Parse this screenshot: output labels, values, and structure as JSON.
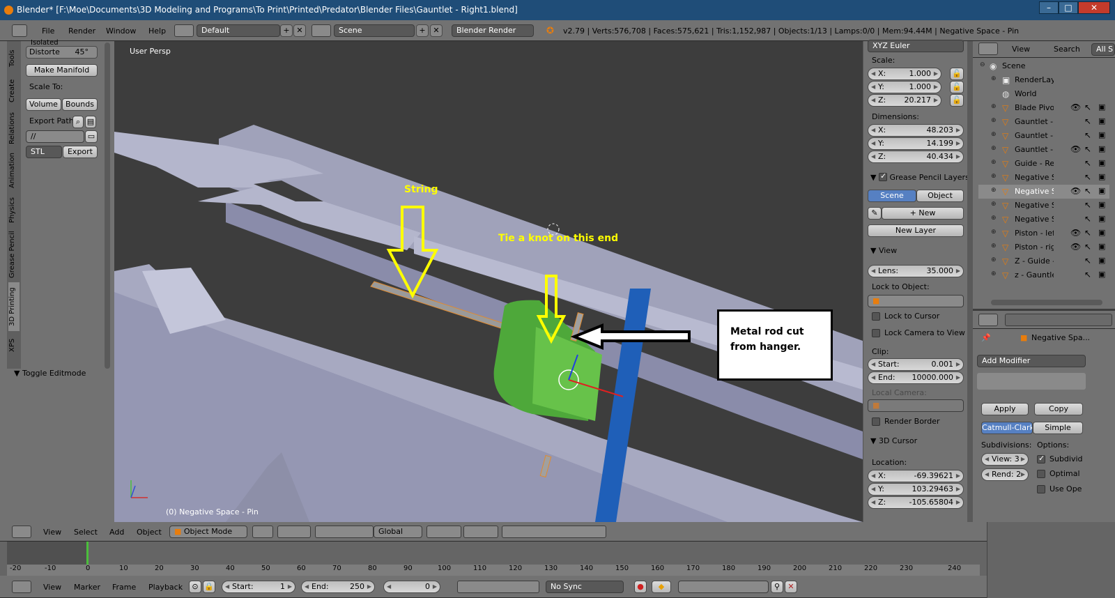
{
  "window": {
    "title": "Blender* [F:\\Moe\\Documents\\3D Modeling and Programs\\To Print\\Printed\\Predator\\Blender Files\\Gauntlet - Right1.blend]"
  },
  "menubar": {
    "items": [
      "File",
      "Render",
      "Window",
      "Help"
    ],
    "layout": "Default",
    "scene": "Scene",
    "engine": "Blender Render",
    "stats": "v2.79 | Verts:576,708 | Faces:575,621 | Tris:1,152,987 | Objects:1/13 | Lamps:0/0 | Mem:94.44M | Negative Space - Pin"
  },
  "toolshelf": {
    "isolated": "Isolated",
    "distort_label": "Distorte",
    "distort_value": "45°",
    "make_manifold": "Make Manifold",
    "scale_to": "Scale To:",
    "volume": "Volume",
    "bounds": "Bounds",
    "export_path": "Export Path:",
    "path_value": "//",
    "format": "STL",
    "export": "Export",
    "toggle_editmode": "Toggle Editmode",
    "tabs": [
      "Tools",
      "Create",
      "Relations",
      "Animation",
      "Physics",
      "Grease Pencil",
      "3D Printing",
      "XPS"
    ]
  },
  "viewport": {
    "persp_label": "User Persp",
    "object_label": "(0) Negative Space - Pin",
    "annotations": {
      "string": "String",
      "tie_knot": "Tie a knot on this end",
      "metal_rod": "Metal rod cut from hanger."
    }
  },
  "properties": {
    "rotation_mode": "XYZ Euler",
    "scale": {
      "label": "Scale:",
      "x": "1.000",
      "y": "1.000",
      "z": "20.217"
    },
    "dimensions": {
      "label": "Dimensions:",
      "x": "48.203",
      "y": "14.199",
      "z": "40.434"
    },
    "grease": {
      "title": "Grease Pencil Layers",
      "scene": "Scene",
      "object": "Object",
      "new": "New",
      "new_layer": "New Layer"
    },
    "view": {
      "title": "View",
      "lens_label": "Lens:",
      "lens": "35.000",
      "lock_to_object": "Lock to Object:",
      "lock_cursor": "Lock to Cursor",
      "lock_camera": "Lock Camera to View",
      "clip": "Clip:",
      "start_label": "Start:",
      "start": "0.001",
      "end_label": "End:",
      "end": "10000.000",
      "local_camera": "Local Camera:",
      "render_border": "Render Border"
    },
    "cursor": {
      "title": "3D Cursor",
      "location": "Location:",
      "x": "-69.39621",
      "y": "103.29463",
      "z": "-105.65804"
    }
  },
  "outliner": {
    "view": "View",
    "search": "Search",
    "all": "All S",
    "items": [
      "Scene",
      "RenderLay",
      "World",
      "Blade Pivo",
      "Gauntlet -",
      "Gauntlet -",
      "Gauntlet -",
      "Guide - Re",
      "Negative S",
      "Negative S",
      "Negative S",
      "Negative S",
      "Piston - lef",
      "Piston - rig",
      "Z - Guide -",
      "z - Gauntle"
    ]
  },
  "modifiers": {
    "object": "Negative Spa...",
    "add": "Add Modifier",
    "apply": "Apply",
    "copy": "Copy",
    "catmull": "Catmull-Clark",
    "simple": "Simple",
    "subdivisions": "Subdivisions:",
    "options": "Options:",
    "view_label": "View: 3",
    "render_label": "Rend: 2",
    "subdiv": "Subdivid",
    "optimal": "Optimal",
    "use_opensubdiv": "Use Ope"
  },
  "viewport_header": {
    "items": [
      "View",
      "Select",
      "Add",
      "Object"
    ],
    "mode": "Object Mode",
    "orientation": "Global"
  },
  "timeline": {
    "ticks": [
      "-20",
      "-10",
      "0",
      "10",
      "20",
      "30",
      "40",
      "50",
      "60",
      "70",
      "80",
      "90",
      "100",
      "110",
      "120",
      "130",
      "140",
      "150",
      "160",
      "170",
      "180",
      "190",
      "200",
      "210",
      "220",
      "230",
      "240"
    ],
    "menu": [
      "View",
      "Marker",
      "Frame",
      "Playback"
    ],
    "start_label": "Start:",
    "start": "1",
    "end_label": "End:",
    "end": "250",
    "current": "0",
    "sync": "No Sync"
  },
  "colors": {
    "accent": "#5680c2",
    "object_green": "#5cb03a",
    "rod_blue": "#1f5fb8",
    "annotation_yellow": "#ffff00"
  }
}
